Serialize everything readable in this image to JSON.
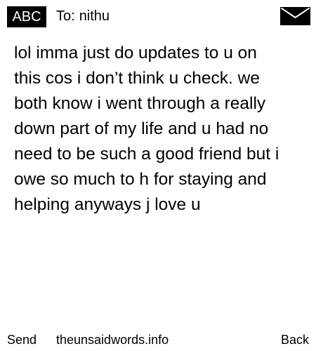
{
  "header": {
    "mode_label": "ABC",
    "recipient_prefix": "To:",
    "recipient_name": "nithu",
    "icon": "envelope-icon"
  },
  "message": {
    "body": "lol imma just do updates to u on\nthis cos i don’t think u check. we\nboth know i went through a really\ndown part of my life and u had no\nneed to be such a good friend but i\nowe so much to h for staying and\nhelping anyways j love u"
  },
  "footer": {
    "send_label": "Send",
    "site_label": "theunsaidwords.info",
    "back_label": "Back"
  },
  "colors": {
    "background": "#ffffff",
    "text": "#000000",
    "badge_background": "#000000",
    "badge_text": "#ffffff"
  }
}
